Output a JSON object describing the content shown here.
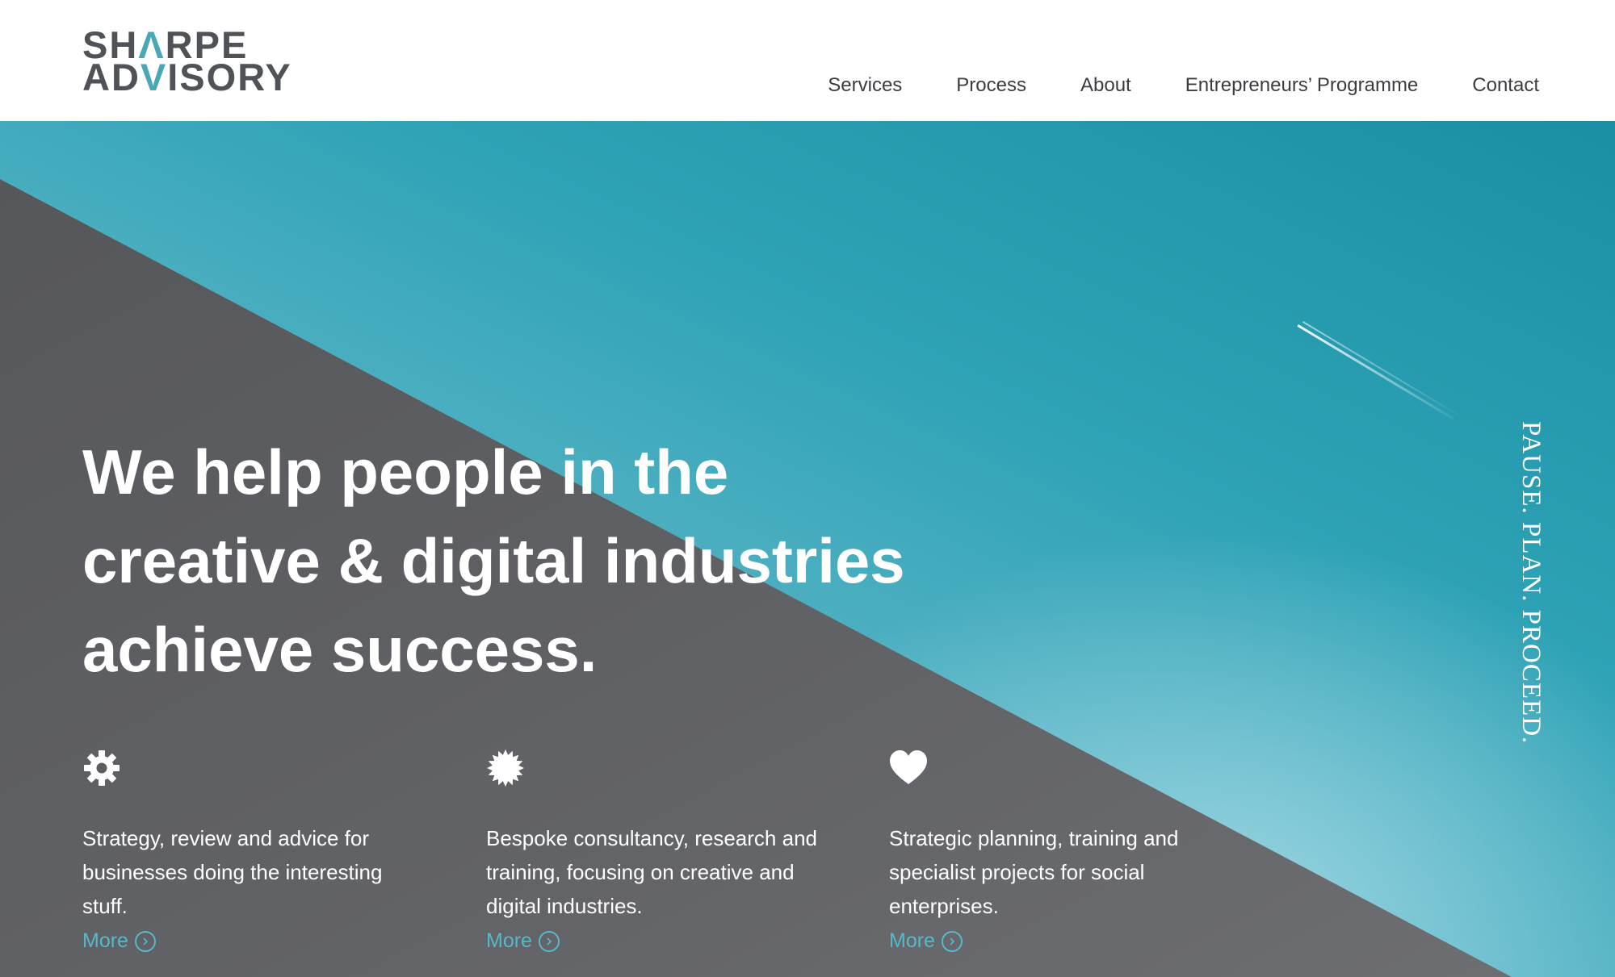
{
  "logo": {
    "line1_before": "SH",
    "line1_accent": "Λ",
    "line1_after": "RPE",
    "line2_before": "AD",
    "line2_accent": "V",
    "line2_after": "ISORY"
  },
  "nav": {
    "items": [
      {
        "label": "Services"
      },
      {
        "label": "Process"
      },
      {
        "label": "About"
      },
      {
        "label": "Entrepreneurs’ Programme"
      },
      {
        "label": "Contact"
      }
    ]
  },
  "hero": {
    "headline_line1": "We help people in the",
    "headline_line2": "creative & digital industries",
    "headline_line3": "achieve success.",
    "tagline": "PAUSE. PLAN. PROCEED."
  },
  "features": [
    {
      "icon": "gear-icon",
      "text": "Strategy, review and advice for businesses doing the interesting stuff.",
      "more_label": "More"
    },
    {
      "icon": "starburst-icon",
      "text": "Bespoke consultancy, research and training, focusing on creative and digital industries.",
      "more_label": "More"
    },
    {
      "icon": "heart-icon",
      "text": "Strategic planning, training and specialist projects for social enterprises.",
      "more_label": "More"
    }
  ],
  "colors": {
    "brand_grey": "#4f5357",
    "accent_teal": "#4aa8b6",
    "link_teal": "#56b8c8",
    "sky_teal": "#2fa3b6",
    "wall_grey": "#5b5c60"
  }
}
